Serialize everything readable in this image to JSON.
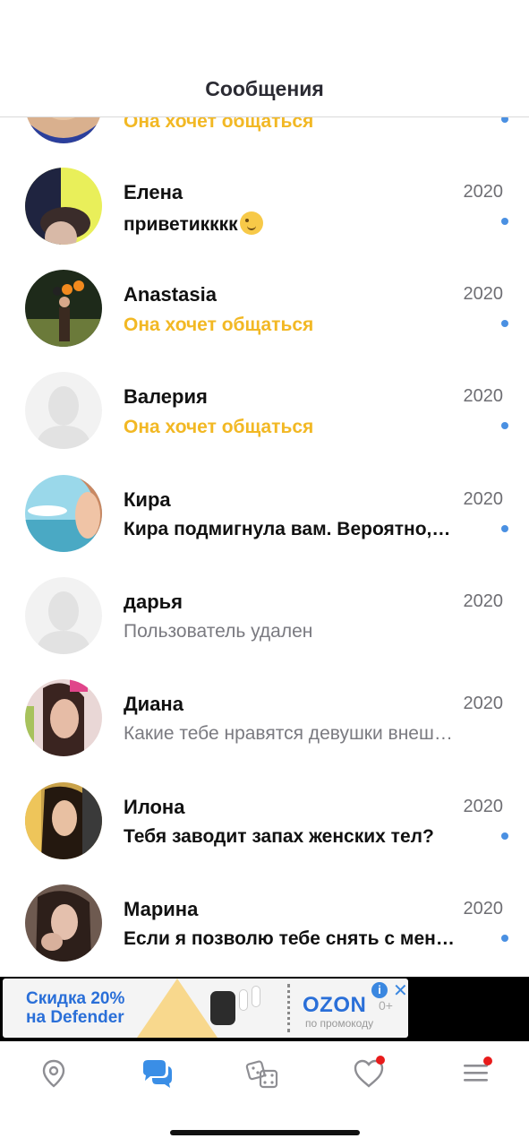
{
  "header": {
    "title": "Сообщения"
  },
  "colors": {
    "accent": "#4a90e2",
    "wants": "#f2b824",
    "unread_dot": "#4a90e2",
    "badge": "#e81b1b",
    "tab_active": "#3a8ee6",
    "tab_inactive": "#8e8e93"
  },
  "conversations": [
    {
      "name": "",
      "year": "",
      "message": "Она хочет общаться",
      "style": "wants",
      "unread": true
    },
    {
      "name": "Елена",
      "year": "2020",
      "message": "приветикккк",
      "style": "unread",
      "emoji": "winking-face-emoji",
      "unread": true
    },
    {
      "name": "Anastasia",
      "year": "2020",
      "message": "Она хочет общаться",
      "style": "wants",
      "unread": true
    },
    {
      "name": "Валерия",
      "year": "2020",
      "message": "Она хочет общаться",
      "style": "wants",
      "unread": true
    },
    {
      "name": "Кира",
      "year": "2020",
      "message": "Кира подмигнула вам. Вероятно, вы ей понравились",
      "style": "unread",
      "unread": true
    },
    {
      "name": "дарья",
      "year": "2020",
      "message": "Пользователь удален",
      "style": "read",
      "unread": false
    },
    {
      "name": "Диана",
      "year": "2020",
      "message": "Какие тебе нравятся девушки внешне?",
      "style": "read",
      "unread": false
    },
    {
      "name": "Илона",
      "year": "2020",
      "message": "Тебя заводит запах женских тел?",
      "style": "unread",
      "unread": true
    },
    {
      "name": "Марина",
      "year": "2020",
      "message": "Если я позволю тебе снять с меня что-нибудь",
      "style": "unread",
      "unread": true
    }
  ],
  "ad": {
    "headline_line1": "Скидка 20%",
    "headline_line2": "на Defender",
    "brand": "OZON",
    "brand_suffix": "0+",
    "subtext": "по промокоду",
    "info_label": "i",
    "close_label": "✕"
  },
  "tabs": [
    {
      "name": "map-pin-icon",
      "active": false,
      "badge": false
    },
    {
      "name": "chat-bubbles-icon",
      "active": true,
      "badge": false
    },
    {
      "name": "dice-icon",
      "active": false,
      "badge": false
    },
    {
      "name": "heart-icon",
      "active": false,
      "badge": true
    },
    {
      "name": "menu-icon",
      "active": false,
      "badge": true
    }
  ]
}
